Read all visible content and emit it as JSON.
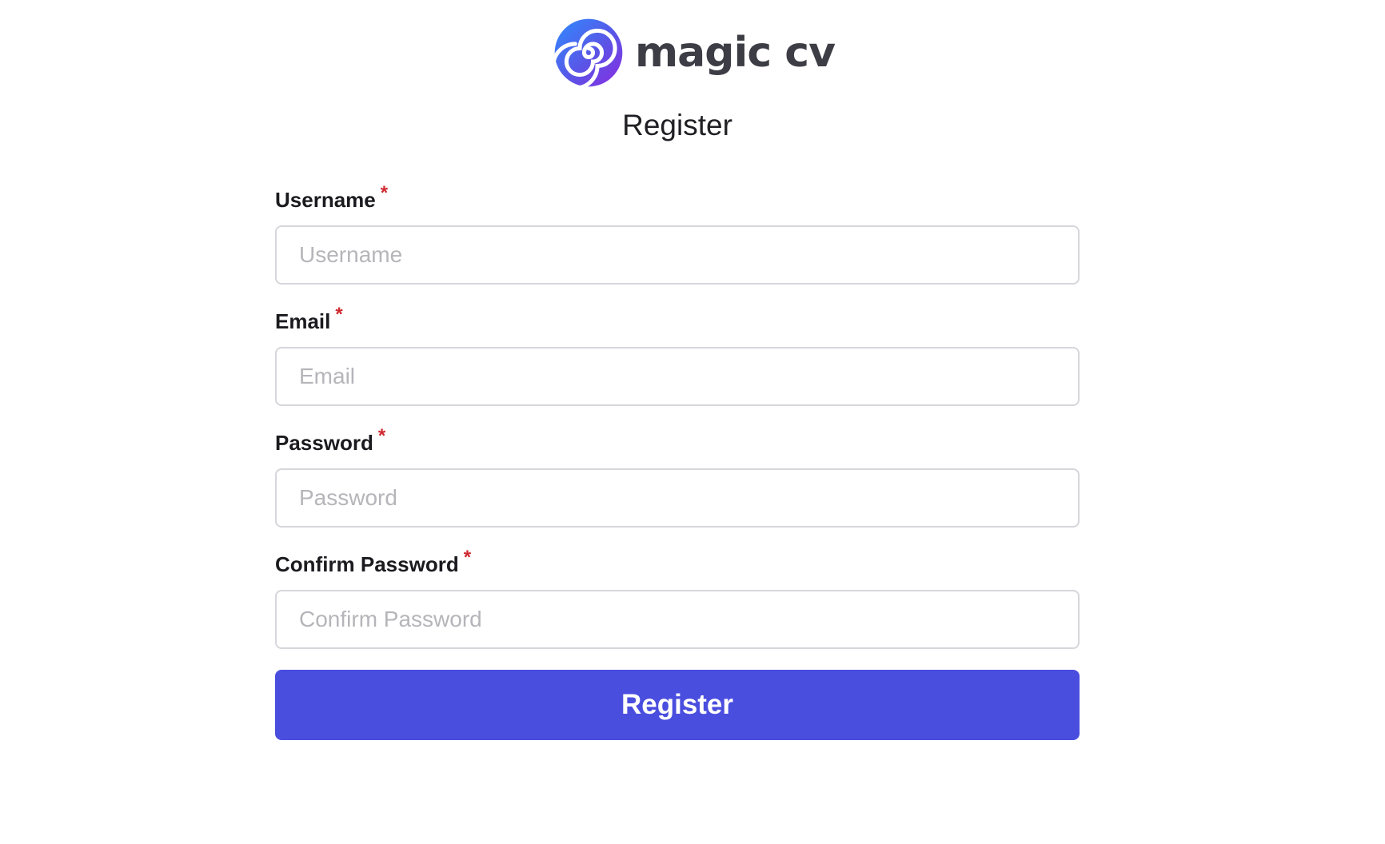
{
  "brand": {
    "name": "magic cv",
    "logo_icon": "spiral-icon",
    "colors": {
      "logo_gradient_start": "#2f8cff",
      "logo_gradient_end": "#8a2be2",
      "text": "#3d3d45"
    }
  },
  "page": {
    "title": "Register"
  },
  "form": {
    "fields": [
      {
        "label": "Username",
        "placeholder": "Username",
        "required_mark": "*",
        "value": ""
      },
      {
        "label": "Email",
        "placeholder": "Email",
        "required_mark": "*",
        "value": ""
      },
      {
        "label": "Password",
        "placeholder": "Password",
        "required_mark": "*",
        "value": ""
      },
      {
        "label": "Confirm Password",
        "placeholder": "Confirm Password",
        "required_mark": "*",
        "value": ""
      }
    ],
    "submit_label": "Register"
  },
  "theme": {
    "accent": "#4a4ede",
    "required_color": "#d0282f",
    "input_border": "#d6d6db",
    "placeholder_color": "#b5b5ba"
  }
}
